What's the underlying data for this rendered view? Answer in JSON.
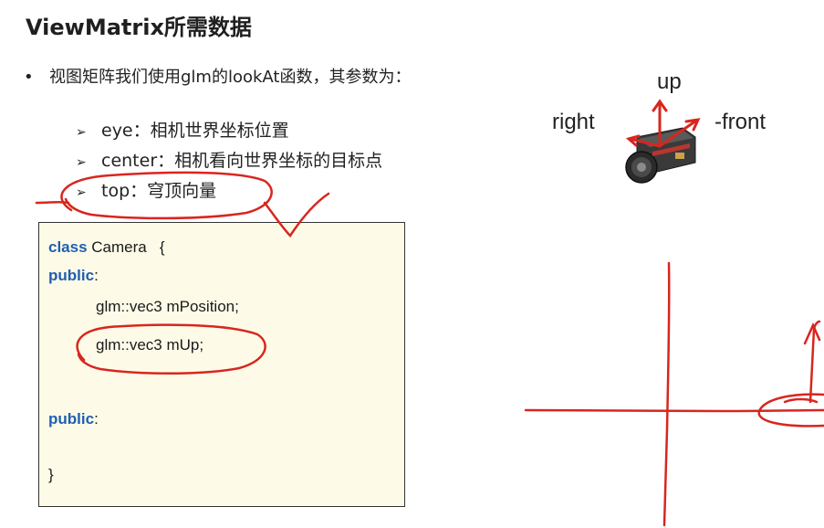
{
  "title": "ViewMatrix所需数据",
  "bullet": {
    "marker": "•",
    "text": "视图矩阵我们使用glm的lookAt函数，其参数为："
  },
  "subitems": [
    {
      "marker": "➢",
      "text": "eye：相机世界坐标位置"
    },
    {
      "marker": "➢",
      "text": "center：相机看向世界坐标的目标点"
    },
    {
      "marker": "➢",
      "text": "top：穹顶向量"
    }
  ],
  "code": {
    "line1_keyword": "class",
    "line1_rest": " Camera   {",
    "line2_keyword": "public",
    "line2_rest": ":",
    "line3": "glm::vec3 mPosition;",
    "line4": "glm::vec3 mUp;",
    "line5_keyword": "public",
    "line5_rest": ":",
    "line6": "}"
  },
  "camera_diagram": {
    "up_label": "up",
    "right_label": "right",
    "front_label": "-front"
  },
  "colors": {
    "annotation_red": "#d8261e",
    "keyword_blue": "#1f5fb0",
    "code_background": "#fdfbe8"
  }
}
